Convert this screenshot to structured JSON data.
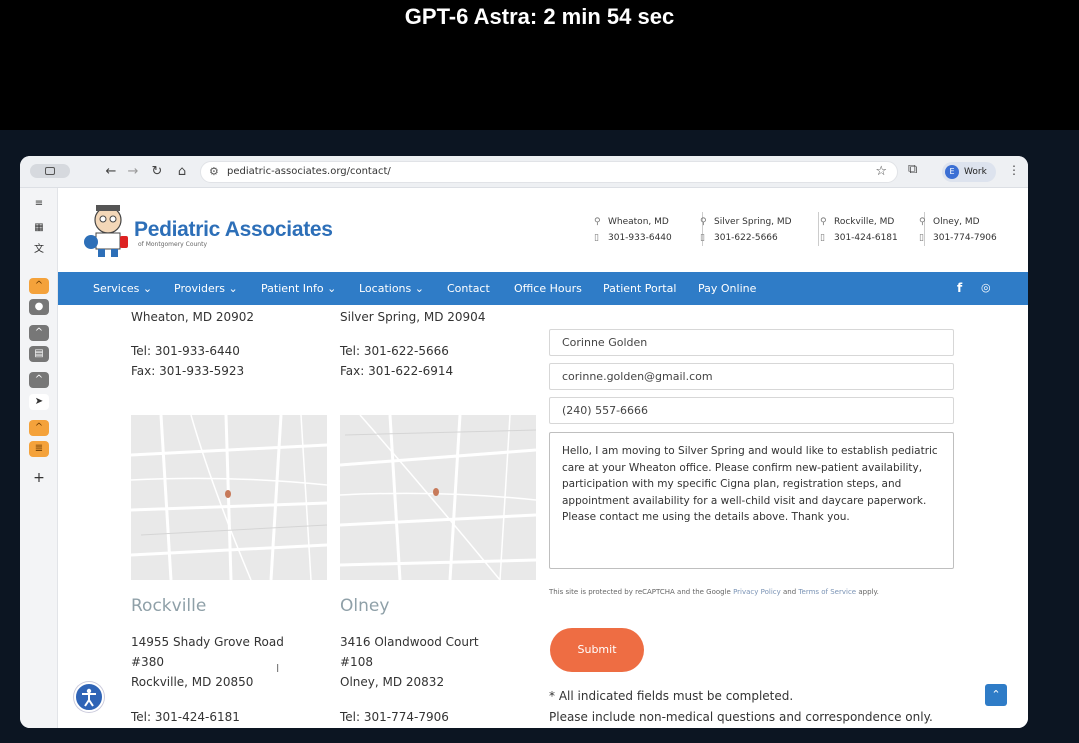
{
  "caption": "GPT-6 Astra: 2 min 54 sec",
  "browser": {
    "url": "pediatric-associates.org/contact/",
    "profile_initial": "E",
    "profile_label": "Work"
  },
  "site": {
    "brand": "Pediatric Associates",
    "brand_sub": "of Montgomery County",
    "locations": [
      {
        "city": "Wheaton, MD",
        "phone": "301-933-6440"
      },
      {
        "city": "Silver Spring, MD",
        "phone": "301-622-5666"
      },
      {
        "city": "Rockville, MD",
        "phone": "301-424-6181"
      },
      {
        "city": "Olney, MD",
        "phone": "301-774-7906"
      }
    ],
    "nav": [
      "Services",
      "Providers",
      "Patient Info",
      "Locations",
      "Contact",
      "Office Hours",
      "Patient Portal",
      "Pay Online"
    ]
  },
  "offices": {
    "wheaton": {
      "citystate": "Wheaton, MD 20902",
      "tel": "Tel: 301-933-6440",
      "fax": "Fax: 301-933-5923"
    },
    "silver_spring": {
      "citystate": "Silver Spring, MD 20904",
      "tel": "Tel: 301-622-5666",
      "fax": "Fax: 301-622-6914"
    },
    "rockville": {
      "name": "Rockville",
      "street": "14955 Shady Grove Road",
      "suite": "#380",
      "citystate": "Rockville, MD 20850",
      "tel": "Tel: 301-424-6181"
    },
    "olney": {
      "name": "Olney",
      "street": "3416 Olandwood Court",
      "suite": "#108",
      "citystate": "Olney, MD 20832",
      "tel": "Tel: 301-774-7906"
    }
  },
  "form": {
    "name": "Corinne Golden",
    "email": "corinne.golden@gmail.com",
    "phone": "(240) 557-6666",
    "message": "Hello, I am moving to Silver Spring and would like to establish pediatric care at your Wheaton office. Please confirm new-patient availability, participation with my specific Cigna plan, registration steps, and appointment availability for a well-child visit and daycare paperwork. Please contact me using the details above. Thank you.",
    "recaptcha_pre": "This site is protected by reCAPTCHA and the Google ",
    "privacy": "Privacy Policy",
    "and": " and ",
    "terms": "Terms of Service",
    "apply": " apply.",
    "submit": "Submit",
    "note1": "* All indicated fields must be completed.",
    "note2": "Please include non-medical questions and correspondence only."
  },
  "colors": {
    "nav": "#2f7cc7",
    "submit": "#ee6d43",
    "brand": "#2d6fb8"
  }
}
